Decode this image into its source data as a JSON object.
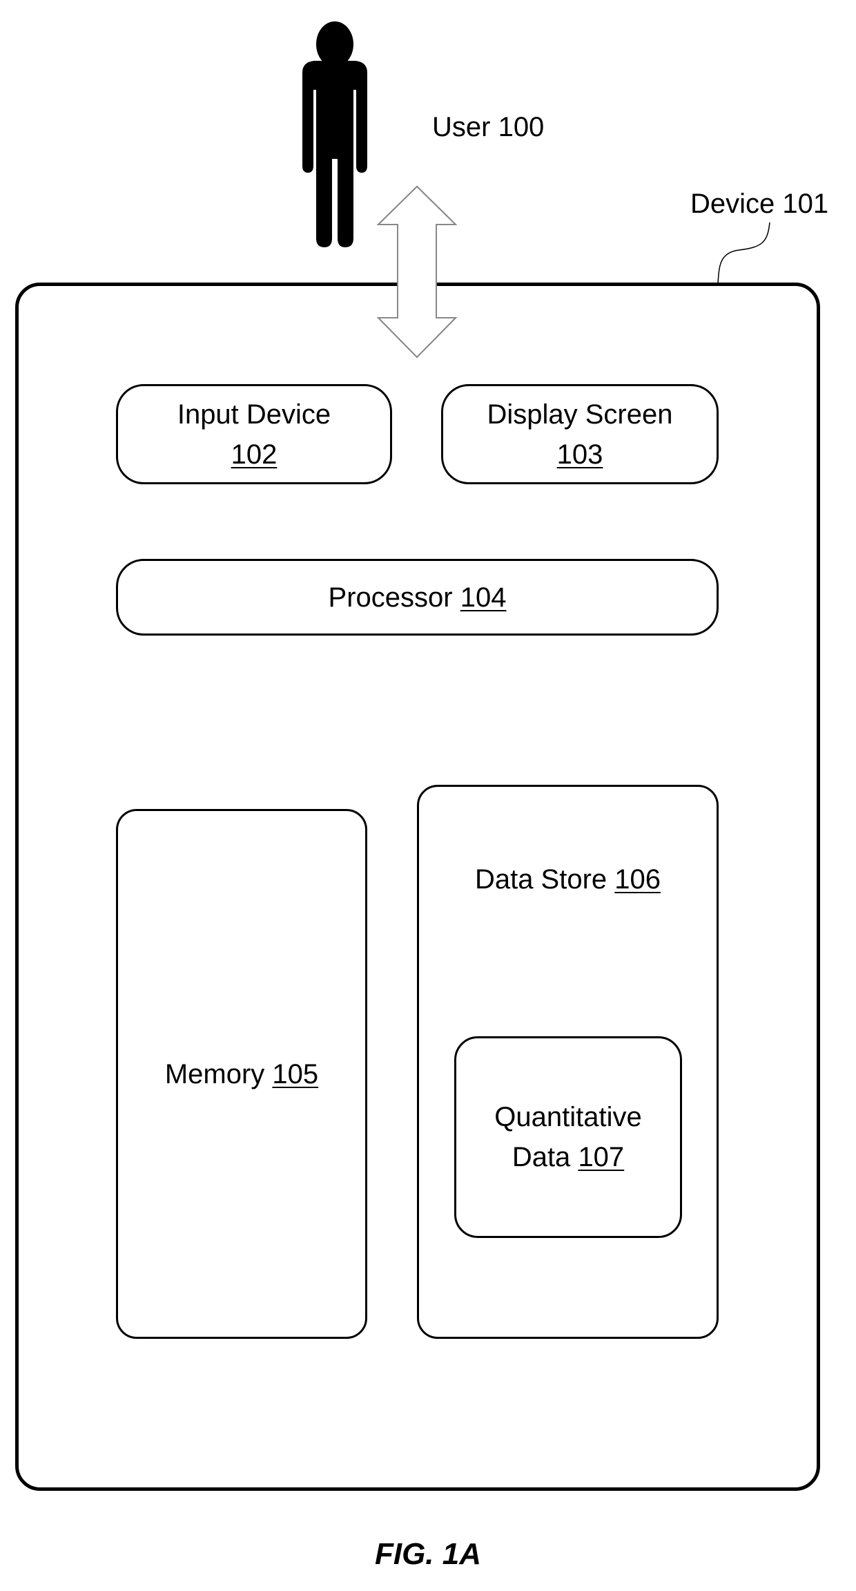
{
  "diagram": {
    "user": {
      "label": "User 100"
    },
    "device": {
      "label": "Device 101"
    },
    "components": {
      "input_device": {
        "name": "Input Device",
        "ref": "102"
      },
      "display_screen": {
        "name": "Display Screen",
        "ref": "103"
      },
      "processor": {
        "name": "Processor",
        "ref": "104"
      },
      "memory": {
        "name": "Memory",
        "ref": "105"
      },
      "data_store": {
        "name": "Data Store",
        "ref": "106"
      },
      "quantitative_data": {
        "name_line1": "Quantitative",
        "name_line2": "Data",
        "ref": "107"
      }
    },
    "caption": "FIG. 1A"
  }
}
